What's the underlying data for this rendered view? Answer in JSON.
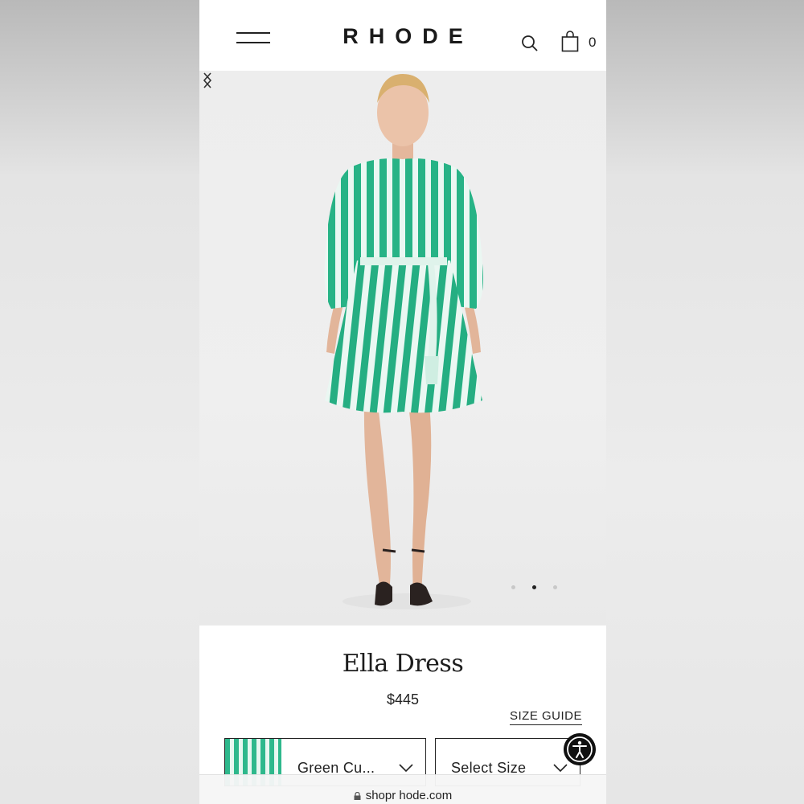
{
  "header": {
    "logo": "RHODE",
    "cart_count": "0"
  },
  "icons": {
    "menu": "hamburger-menu-icon",
    "search": "search-icon",
    "cart": "shopping-bag-icon",
    "prev": "chevron-left-icon",
    "next": "chevron-right-icon",
    "accessibility": "accessibility-icon",
    "lock": "lock-icon"
  },
  "gallery": {
    "slide_count": 3,
    "active_slide": 2
  },
  "product": {
    "title": "Ella Dress",
    "price": "$445",
    "size_guide": "SIZE GUIDE",
    "color_select": "Green Cu...",
    "size_select": "Select Size"
  },
  "browser": {
    "url": "shopr hode.com"
  },
  "colors": {
    "stripe_green": "#2eb88c",
    "text": "#222222",
    "background": "#ffffff"
  }
}
